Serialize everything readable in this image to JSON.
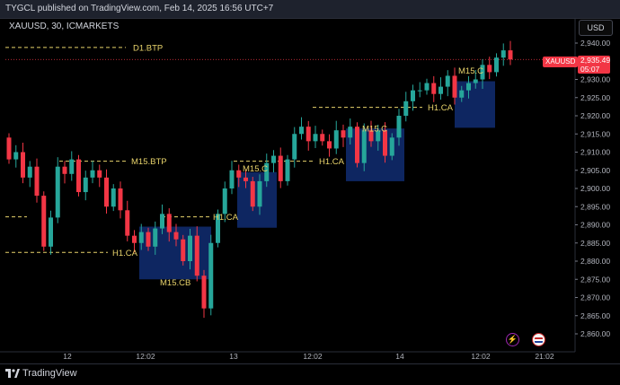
{
  "header": {
    "text": "TYGCL published on TradingView.com, Feb 14, 2025 16:56 UTC+7"
  },
  "symbol": "XAUUSD, 30, ICMARKETS",
  "currency_button": "USD",
  "price_tag": {
    "price": "2,935.49",
    "countdown": "05:07",
    "symbol": "XAUUSD"
  },
  "brand": "TradingView",
  "icons": {
    "lightning": "lightning-icon",
    "flag": "us-flag-icon",
    "logo": "tradingview-logo-icon"
  },
  "colors": {
    "up": "#26a69a",
    "down": "#f23645",
    "zone": "#0f2a6b",
    "level": "#e8d36b",
    "background": "#000000"
  },
  "chart_data": {
    "type": "candlestick",
    "y_ticks": [
      "2,940.00",
      "2,935.00",
      "2,930.00",
      "2,925.00",
      "2,920.00",
      "2,915.00",
      "2,910.00",
      "2,905.00",
      "2,900.00",
      "2,895.00",
      "2,890.00",
      "2,885.00",
      "2,880.00",
      "2,875.00",
      "2,870.00",
      "2,865.00",
      "2,860.00"
    ],
    "ylim": [
      2858,
      2944
    ],
    "x_ticks": [
      "12",
      "12:02",
      "13",
      "12:02",
      "14",
      "12:02",
      "21:02"
    ],
    "last_price": 2935.49,
    "annotations": [
      {
        "label": "D1.BTP",
        "price": 2938.8
      },
      {
        "label": "M15.BTP",
        "price": 2907.5
      },
      {
        "label": "H1.CA",
        "price": 2907.5
      },
      {
        "label": "H1.CA",
        "price": 2892.2
      },
      {
        "label": "H1.CA",
        "price": 2882.4
      },
      {
        "label": "H1.CA",
        "price": 2922.3
      },
      {
        "label": "M15.CB",
        "price": 2875.0
      },
      {
        "label": "M15.C",
        "price": 2905.0
      },
      {
        "label": "M15.C",
        "price": 2917.0
      },
      {
        "label": "M15.C",
        "price": 2932.0
      }
    ],
    "zones": [
      {
        "x0": 2.1,
        "x1": 3.6,
        "price_top": 2889.5,
        "price_bottom": 2875.0
      },
      {
        "x0": 3.55,
        "x1": 4.25,
        "price_top": 2904.5,
        "price_bottom": 2889.2
      },
      {
        "x0": 5.35,
        "x1": 6.25,
        "price_top": 2916.5,
        "price_bottom": 2902.0
      },
      {
        "x0": 7.0,
        "x1": 7.6,
        "price_top": 2929.5,
        "price_bottom": 2916.7
      }
    ],
    "price_path": [
      [
        2914,
        2908
      ],
      [
        2908,
        2910
      ],
      [
        2910,
        2903
      ],
      [
        2903,
        2906
      ],
      [
        2906,
        2898
      ],
      [
        2898,
        2884
      ],
      [
        2884,
        2892
      ],
      [
        2892,
        2906
      ],
      [
        2906,
        2904
      ],
      [
        2904,
        2908
      ],
      [
        2908,
        2899
      ],
      [
        2899,
        2903
      ],
      [
        2903,
        2905
      ],
      [
        2905,
        2903
      ],
      [
        2903,
        2895
      ],
      [
        2895,
        2900
      ],
      [
        2900,
        2894
      ],
      [
        2894,
        2887
      ],
      [
        2887,
        2885
      ],
      [
        2885,
        2888
      ],
      [
        2888,
        2884
      ],
      [
        2884,
        2889
      ],
      [
        2889,
        2893
      ],
      [
        2893,
        2888
      ],
      [
        2888,
        2886
      ],
      [
        2886,
        2880
      ],
      [
        2880,
        2887
      ],
      [
        2887,
        2876
      ],
      [
        2876,
        2867
      ],
      [
        2867,
        2885
      ],
      [
        2885,
        2893
      ],
      [
        2893,
        2900
      ],
      [
        2900,
        2905
      ],
      [
        2905,
        2903
      ],
      [
        2903,
        2902
      ],
      [
        2902,
        2895
      ],
      [
        2895,
        2902
      ],
      [
        2902,
        2907
      ],
      [
        2907,
        2909
      ],
      [
        2909,
        2902
      ],
      [
        2902,
        2908
      ],
      [
        2908,
        2915
      ],
      [
        2915,
        2917
      ],
      [
        2917,
        2913
      ],
      [
        2913,
        2915
      ],
      [
        2915,
        2913
      ],
      [
        2913,
        2911
      ],
      [
        2911,
        2916
      ],
      [
        2916,
        2914
      ],
      [
        2914,
        2917
      ],
      [
        2917,
        2907
      ],
      [
        2907,
        2916
      ],
      [
        2916,
        2913
      ],
      [
        2913,
        2916
      ],
      [
        2916,
        2909
      ],
      [
        2909,
        2914
      ],
      [
        2914,
        2920
      ],
      [
        2920,
        2924
      ],
      [
        2924,
        2927
      ],
      [
        2927,
        2927
      ],
      [
        2927,
        2929
      ],
      [
        2929,
        2926
      ],
      [
        2926,
        2928
      ],
      [
        2928,
        2931
      ],
      [
        2931,
        2925
      ],
      [
        2925,
        2927
      ],
      [
        2927,
        2929
      ],
      [
        2929,
        2930
      ],
      [
        2930,
        2934
      ],
      [
        2934,
        2932
      ],
      [
        2932,
        2936
      ],
      [
        2936,
        2938
      ],
      [
        2938,
        2935.49
      ]
    ]
  }
}
